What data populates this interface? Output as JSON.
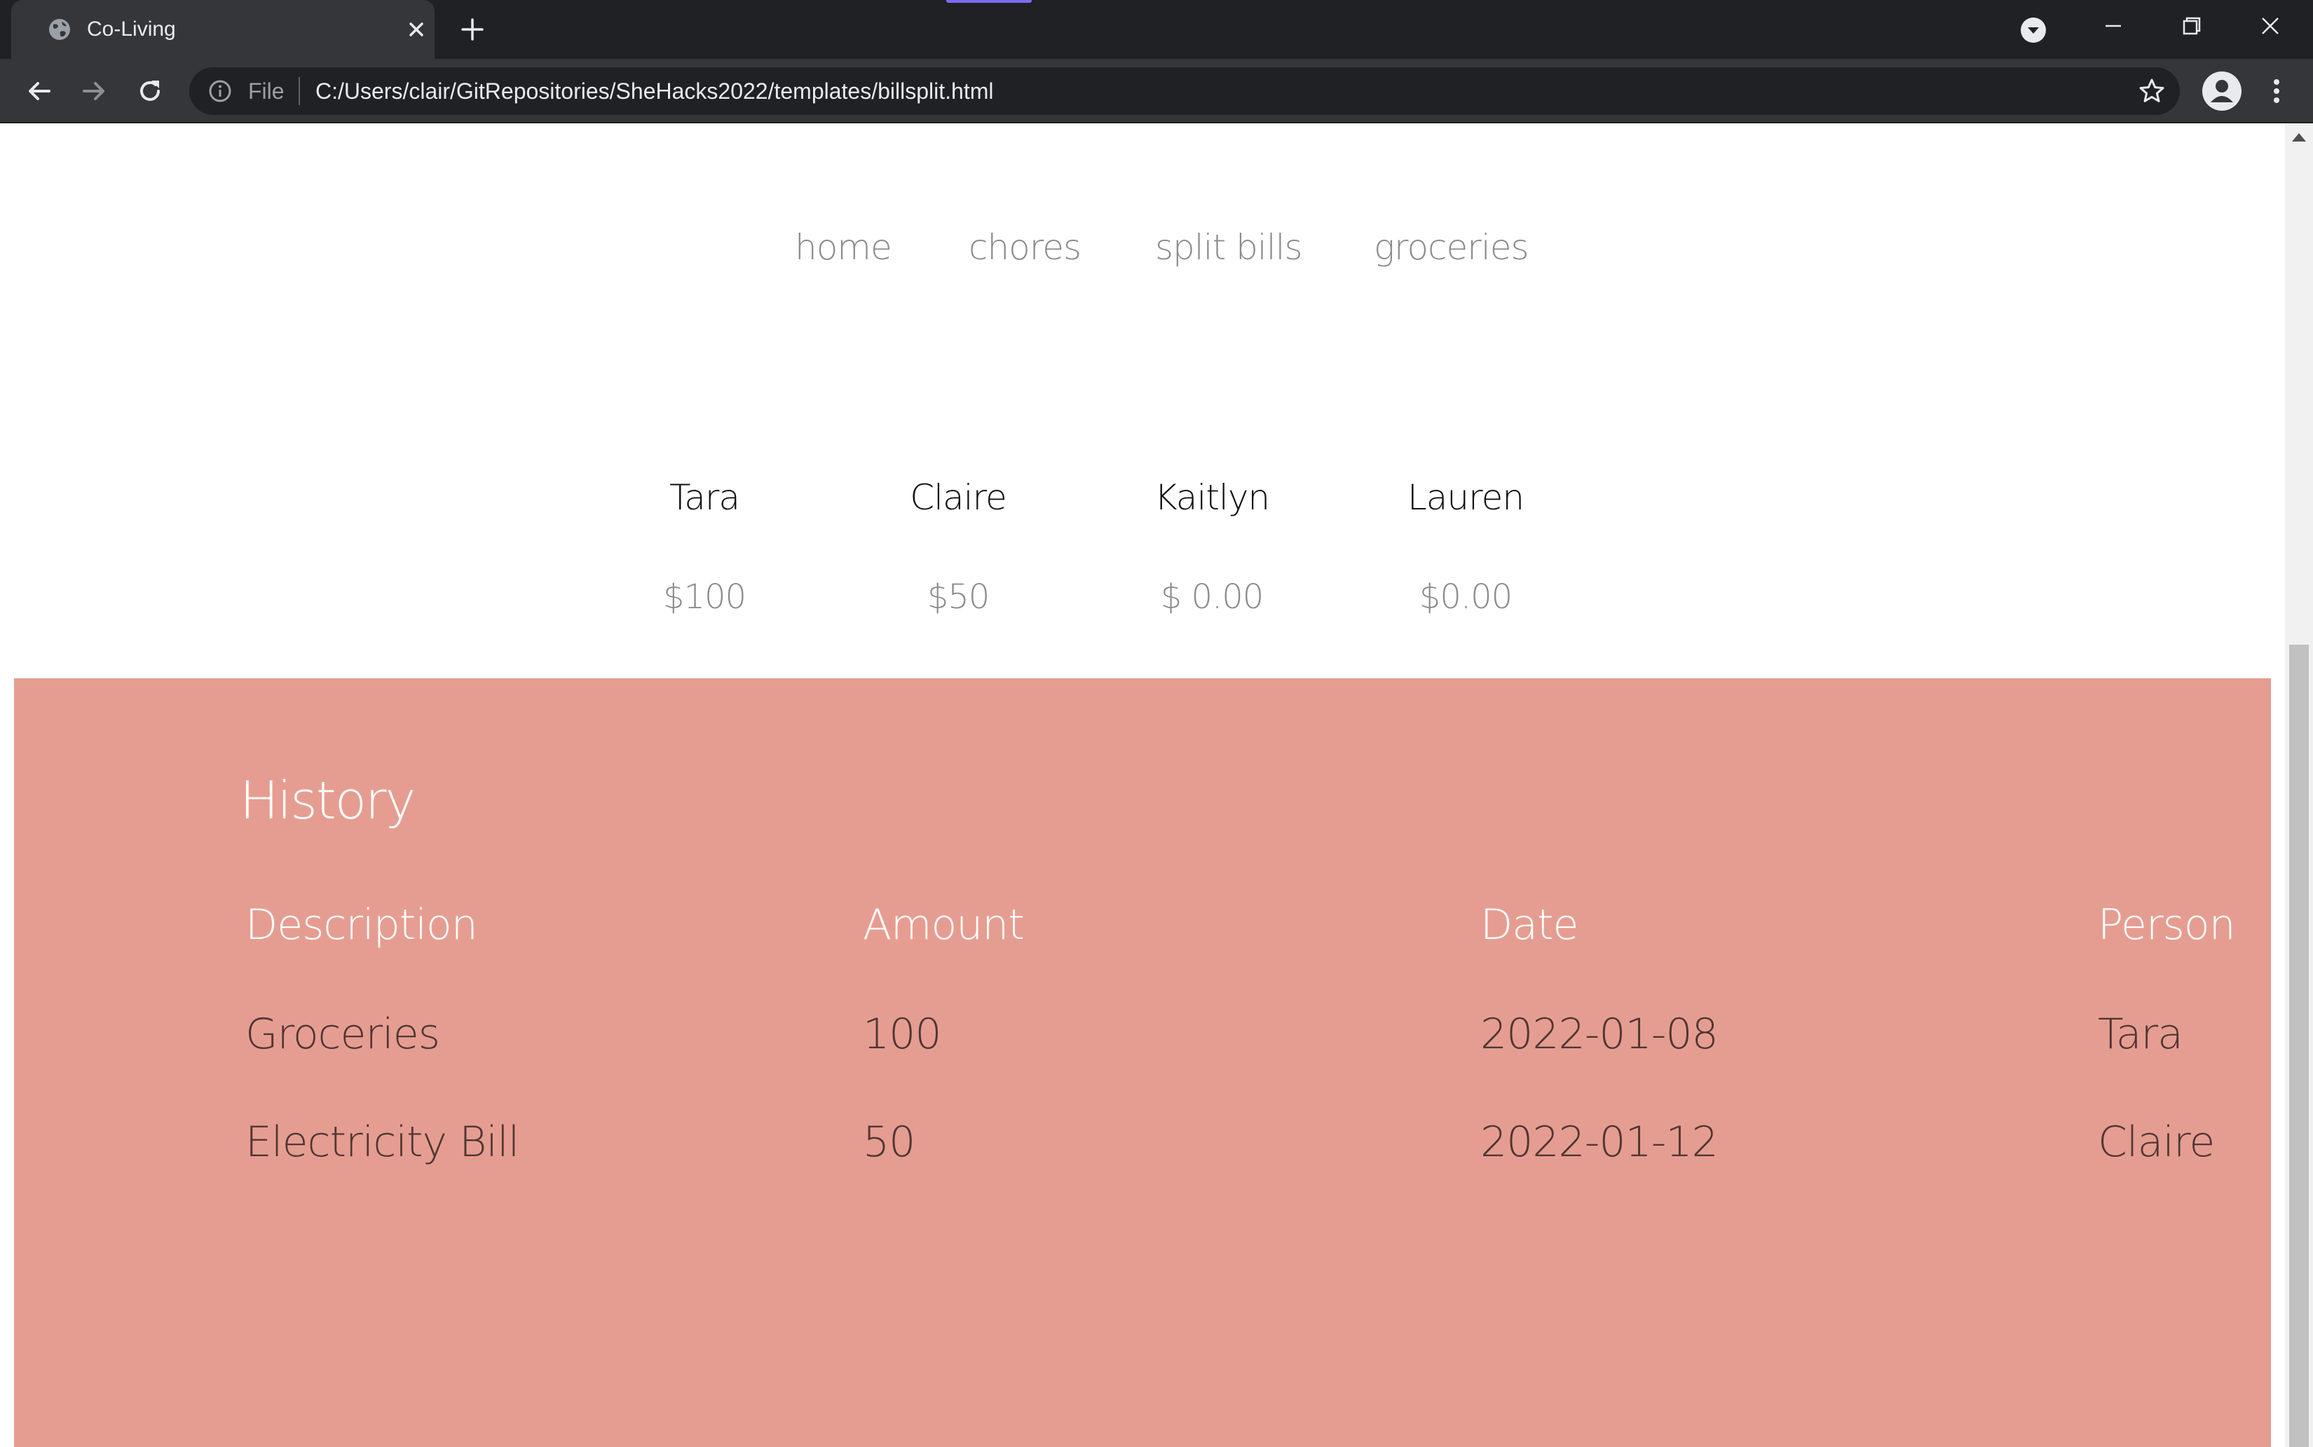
{
  "browser": {
    "tab_title": "Co-Living",
    "scheme_label": "File",
    "url": "C:/Users/clair/GitRepositories/SheHacks2022/templates/billsplit.html"
  },
  "nav": {
    "items": [
      {
        "label": "home"
      },
      {
        "label": "chores"
      },
      {
        "label": "split bills"
      },
      {
        "label": "groceries"
      }
    ]
  },
  "balances": [
    {
      "name": "Tara",
      "amount": "$100"
    },
    {
      "name": "Claire",
      "amount": "$50"
    },
    {
      "name": "Kaitlyn",
      "amount": "$ 0.00"
    },
    {
      "name": "Lauren",
      "amount": "$0.00"
    }
  ],
  "history": {
    "title": "History",
    "columns": [
      "Description",
      "Amount",
      "Date",
      "Person"
    ],
    "rows": [
      [
        "Groceries",
        "100",
        "2022-01-08",
        "Tara"
      ],
      [
        "Electricity Bill",
        "50",
        "2022-01-12",
        "Claire"
      ]
    ]
  },
  "colors": {
    "history_bg": "#e69d91",
    "chrome_dark": "#202124",
    "chrome_toolbar": "#35363a",
    "tab_indicator": "#7b6cf6"
  }
}
